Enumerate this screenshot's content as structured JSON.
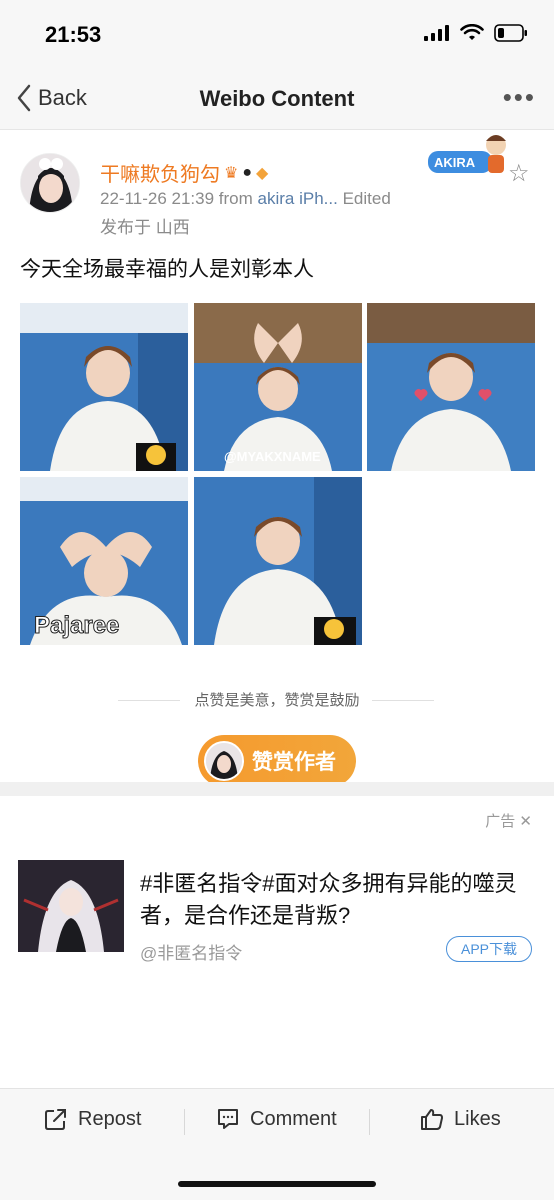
{
  "status_bar": {
    "time": "21:53"
  },
  "nav": {
    "back_label": "Back",
    "title": "Weibo Content"
  },
  "post": {
    "author": "干嘛欺负狗勾",
    "timestamp": "22-11-26 21:39",
    "source_prefix": "from",
    "source": "akira iPh...",
    "edited": "Edited",
    "location": "发布于 山西",
    "badge_text": "AKIRA",
    "text": "今天全场最幸福的人是刘彰本人",
    "photo_captions": [
      "",
      "@MYAKXNAME",
      "",
      "Pajaree",
      ""
    ]
  },
  "reward": {
    "prompt": "点赞是美意，赞赏是鼓励",
    "button_label": "赞赏作者"
  },
  "share": [
    "wechat-icon",
    "moments-icon",
    "qq-icon",
    "save-image-icon"
  ],
  "ad": {
    "label": "广告",
    "title": "#非匿名指令#面对众多拥有异能的噬灵者，是合作还是背叛?",
    "source": "@非匿名指令",
    "download_label": "APP下载"
  },
  "actions": {
    "repost": "Repost",
    "comment": "Comment",
    "likes": "Likes"
  },
  "colors": {
    "accent_orange": "#ee7a22",
    "reward_orange": "#f59a2e",
    "link_blue": "#5a7ea8"
  }
}
